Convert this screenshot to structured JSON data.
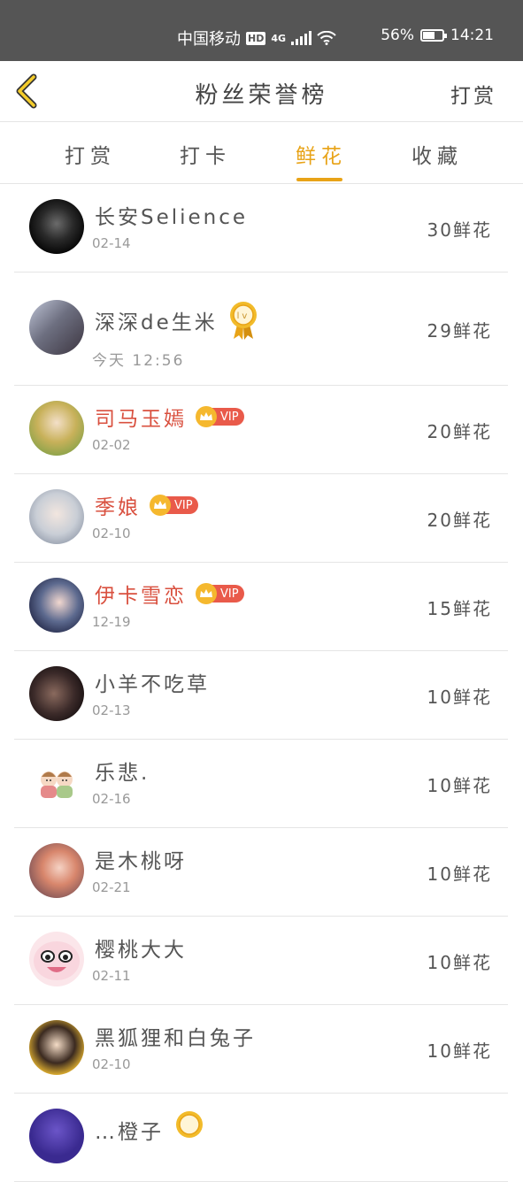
{
  "status": {
    "carrier": "中国移动",
    "hd": "HD",
    "network": "4G",
    "battery": "56%",
    "time": "14:21"
  },
  "header": {
    "title": "粉丝荣誉榜",
    "right_action": "打赏"
  },
  "tabs": [
    {
      "label": "打赏"
    },
    {
      "label": "打卡"
    },
    {
      "label": "鲜花"
    },
    {
      "label": "收藏"
    }
  ],
  "active_tab": "鲜花",
  "accent_color": "#e8a317",
  "vip_label": "VIP",
  "fans": [
    {
      "name": "长安Selience",
      "date": "02-14",
      "count": "30鲜花"
    },
    {
      "name": "深深de生米",
      "date": "今天 12:56",
      "count": "29鲜花"
    },
    {
      "name": "司马玉嫣",
      "date": "02-02",
      "count": "20鲜花"
    },
    {
      "name": "季娘",
      "date": "02-10",
      "count": "20鲜花"
    },
    {
      "name": "伊卡雪恋",
      "date": "12-19",
      "count": "15鲜花"
    },
    {
      "name": "小羊不吃草",
      "date": "02-13",
      "count": "10鲜花"
    },
    {
      "name": "乐悲.",
      "date": "02-16",
      "count": "10鲜花"
    },
    {
      "name": "是木桃呀",
      "date": "02-21",
      "count": "10鲜花"
    },
    {
      "name": "樱桃大大",
      "date": "02-11",
      "count": "10鲜花"
    },
    {
      "name": "黑狐狸和白兔子",
      "date": "02-10",
      "count": "10鲜花"
    },
    {
      "name": "…橙子",
      "date": "",
      "count": ""
    }
  ]
}
